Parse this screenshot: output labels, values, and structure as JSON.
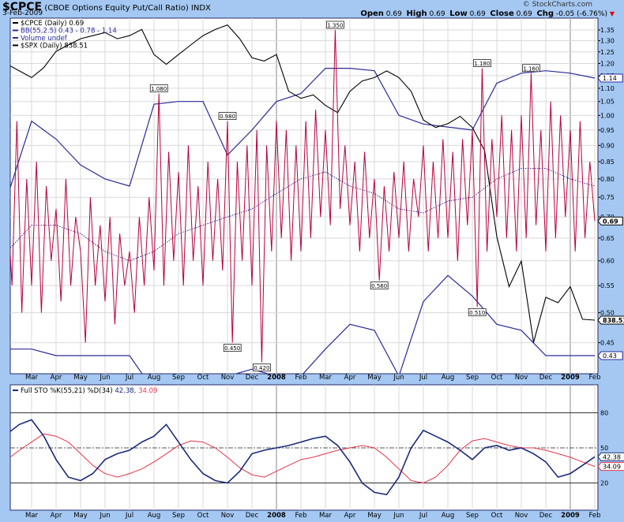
{
  "header": {
    "symbol": "$CPCE",
    "description": "(CBOE Options Equity Put/Call Ratio)",
    "exchange": "INDX",
    "date": "3-Feb-2009",
    "copyright": "© StockCharts.com",
    "open_label": "Open",
    "open": "0.69",
    "high_label": "High",
    "high": "0.69",
    "low_label": "Low",
    "low": "0.69",
    "close_label": "Close",
    "close": "0.69",
    "chg_label": "Chg",
    "chg": "-0.05 (-6.76%)"
  },
  "legend_main": [
    {
      "text": "$CPCE (Daily) 0.69",
      "color": "#000000"
    },
    {
      "text": "BB(55,2.5) 0.43 - 0.78 - 1.14",
      "color": "#2a2a9a"
    },
    {
      "text": "Volume undef",
      "color": "#2a2a9a"
    },
    {
      "text": "$SPX (Daily) 838.51",
      "color": "#000000"
    }
  ],
  "legend_sto": {
    "label": "Full STO %K(55,21) %D(34)",
    "k": "42.38,",
    "d": "34.09"
  },
  "colors": {
    "cpce": "#b8003a",
    "bb": "#2a2a9a",
    "spx": "#000000",
    "sto_k": "#1a2a7a",
    "sto_d": "#e8344a",
    "grid": "#d9d9d9"
  },
  "chart_data": [
    {
      "type": "line",
      "title": "$CPCE (CBOE Options Equity Put/Call Ratio)",
      "x_unit": "months since 1-Feb-2007",
      "x_ticks": [
        {
          "t": 1,
          "label": "Mar"
        },
        {
          "t": 2,
          "label": "Apr"
        },
        {
          "t": 3,
          "label": "May"
        },
        {
          "t": 4,
          "label": "Jun"
        },
        {
          "t": 5,
          "label": "Jul"
        },
        {
          "t": 6,
          "label": "Aug"
        },
        {
          "t": 7,
          "label": "Sep"
        },
        {
          "t": 8,
          "label": "Oct"
        },
        {
          "t": 9,
          "label": "Nov"
        },
        {
          "t": 10,
          "label": "Dec"
        },
        {
          "t": 11,
          "label": "2008",
          "bold": true
        },
        {
          "t": 12,
          "label": "Feb"
        },
        {
          "t": 13,
          "label": "Mar"
        },
        {
          "t": 14,
          "label": "Apr"
        },
        {
          "t": 15,
          "label": "May"
        },
        {
          "t": 16,
          "label": "Jun"
        },
        {
          "t": 17,
          "label": "Jul"
        },
        {
          "t": 18,
          "label": "Aug"
        },
        {
          "t": 19,
          "label": "Sep"
        },
        {
          "t": 20,
          "label": "Oct"
        },
        {
          "t": 21,
          "label": "Nov"
        },
        {
          "t": 22,
          "label": "Dec"
        },
        {
          "t": 23,
          "label": "2009",
          "bold": true
        },
        {
          "t": 24,
          "label": "Feb"
        }
      ],
      "y_scale": "log",
      "y_ticks": [
        "1.35",
        "1.30",
        "1.25",
        "1.20",
        "1.15",
        "1.10",
        "1.05",
        "1.00",
        "0.95",
        "0.90",
        "0.85",
        "0.80",
        "0.75",
        "0.70",
        "0.65",
        "0.60",
        "0.55",
        "0.50",
        "0.45"
      ],
      "ylim": [
        0.4,
        1.4
      ],
      "cpce_step": 0.2,
      "cpce": [
        0.75,
        0.55,
        0.98,
        0.5,
        0.8,
        0.55,
        0.85,
        0.5,
        0.78,
        0.6,
        0.72,
        0.52,
        0.8,
        0.55,
        0.7,
        0.62,
        0.45,
        0.75,
        0.55,
        0.68,
        0.52,
        0.7,
        0.48,
        0.66,
        0.55,
        0.62,
        0.5,
        0.7,
        0.55,
        0.75,
        0.58,
        1.08,
        0.55,
        0.88,
        0.6,
        0.82,
        0.55,
        0.9,
        0.6,
        0.78,
        0.55,
        0.85,
        0.6,
        0.8,
        0.58,
        0.98,
        0.45,
        0.85,
        0.6,
        0.9,
        0.55,
        0.95,
        0.42,
        0.9,
        0.62,
        0.98,
        0.65,
        0.95,
        0.6,
        0.9,
        0.62,
        0.98,
        0.65,
        1.02,
        0.7,
        0.95,
        0.68,
        1.35,
        0.72,
        0.9,
        0.68,
        0.85,
        0.62,
        0.88,
        0.65,
        0.8,
        0.56,
        0.78,
        0.62,
        0.82,
        0.65,
        0.85,
        0.62,
        0.8,
        0.7,
        0.9,
        0.62,
        0.85,
        0.65,
        0.92,
        0.65,
        0.88,
        0.6,
        0.92,
        0.68,
        0.95,
        0.51,
        1.18,
        0.62,
        0.92,
        0.7,
        1.0,
        0.65,
        0.95,
        0.62,
        1.0,
        0.65,
        1.16,
        0.68,
        0.95,
        0.62,
        1.05,
        0.65,
        1.0,
        0.7,
        0.95,
        0.62,
        0.98,
        0.65,
        0.85,
        0.69
      ],
      "bb_step": 1,
      "bb_upper": [
        0.75,
        0.98,
        0.92,
        0.84,
        0.8,
        0.78,
        1.04,
        1.05,
        1.05,
        0.87,
        0.95,
        1.05,
        1.08,
        1.18,
        1.18,
        1.17,
        1.0,
        0.97,
        0.96,
        0.95,
        1.12,
        1.16,
        1.17,
        1.16,
        1.14
      ],
      "bb_middle": [
        0.62,
        0.68,
        0.68,
        0.66,
        0.62,
        0.6,
        0.62,
        0.66,
        0.68,
        0.7,
        0.72,
        0.76,
        0.8,
        0.82,
        0.78,
        0.76,
        0.72,
        0.71,
        0.74,
        0.75,
        0.8,
        0.83,
        0.83,
        0.8,
        0.78
      ],
      "bb_lower": [
        0.44,
        0.44,
        0.43,
        0.43,
        0.43,
        0.43,
        0.38,
        0.37,
        0.38,
        0.4,
        0.41,
        0.4,
        0.4,
        0.44,
        0.48,
        0.47,
        0.4,
        0.52,
        0.57,
        0.53,
        0.48,
        0.47,
        0.43,
        0.43,
        0.43
      ],
      "spx_step": 0.5,
      "spx": [
        1440,
        1420,
        1400,
        1430,
        1480,
        1500,
        1520,
        1530,
        1540,
        1520,
        1530,
        1550,
        1470,
        1440,
        1470,
        1500,
        1530,
        1550,
        1565,
        1520,
        1460,
        1450,
        1470,
        1360,
        1340,
        1350,
        1320,
        1300,
        1360,
        1390,
        1400,
        1420,
        1400,
        1360,
        1280,
        1260,
        1270,
        1290,
        1260,
        1200,
        1000,
        900,
        950,
        800,
        880,
        870,
        900,
        840,
        838.51
      ],
      "annotations": [
        {
          "t": 6.2,
          "value": 1.08,
          "label": "1.080"
        },
        {
          "t": 9.0,
          "value": 0.98,
          "label": "0.980"
        },
        {
          "t": 9.2,
          "value": 0.45,
          "label": "0.450"
        },
        {
          "t": 10.4,
          "value": 0.42,
          "label": "0.420"
        },
        {
          "t": 13.4,
          "value": 1.35,
          "label": "1.350"
        },
        {
          "t": 15.2,
          "value": 0.56,
          "label": "0.560"
        },
        {
          "t": 19.2,
          "value": 0.51,
          "label": "0.510"
        },
        {
          "t": 19.4,
          "value": 1.18,
          "label": "1.180"
        },
        {
          "t": 21.4,
          "value": 1.16,
          "label": "1.160"
        }
      ],
      "last_tags": [
        {
          "series": "bb_upper",
          "label": "1.14",
          "value": 1.14
        },
        {
          "series": "cpce",
          "label": "0.69",
          "value": 0.69,
          "bold": true
        },
        {
          "series": "spx",
          "label": "838.51",
          "value": 838.51,
          "bold": true
        },
        {
          "series": "bb_lower",
          "label": "0.43",
          "value": 0.43
        }
      ]
    },
    {
      "type": "line",
      "title": "Full STO %K(55,21) %D(34)",
      "ylim": [
        0,
        100
      ],
      "y_ticks": [
        "80",
        "50",
        "20"
      ],
      "step": 0.5,
      "k": [
        62,
        70,
        74,
        60,
        40,
        25,
        22,
        28,
        40,
        45,
        48,
        55,
        60,
        70,
        55,
        40,
        28,
        22,
        20,
        30,
        45,
        48,
        50,
        52,
        55,
        58,
        60,
        52,
        38,
        20,
        12,
        10,
        25,
        50,
        65,
        60,
        55,
        48,
        40,
        50,
        52,
        48,
        50,
        45,
        38,
        25,
        28,
        35,
        42.38
      ],
      "d": [
        40,
        48,
        55,
        62,
        60,
        55,
        45,
        35,
        28,
        25,
        28,
        32,
        38,
        45,
        52,
        56,
        55,
        50,
        42,
        33,
        27,
        25,
        30,
        35,
        40,
        42,
        45,
        48,
        50,
        52,
        50,
        42,
        32,
        22,
        20,
        25,
        35,
        48,
        56,
        58,
        55,
        52,
        50,
        50,
        48,
        45,
        42,
        38,
        34.09
      ],
      "last_tags": [
        {
          "label": "42.38",
          "value": 42.38,
          "series": "k"
        },
        {
          "label": "34.09",
          "value": 34.09,
          "series": "d"
        }
      ]
    }
  ]
}
